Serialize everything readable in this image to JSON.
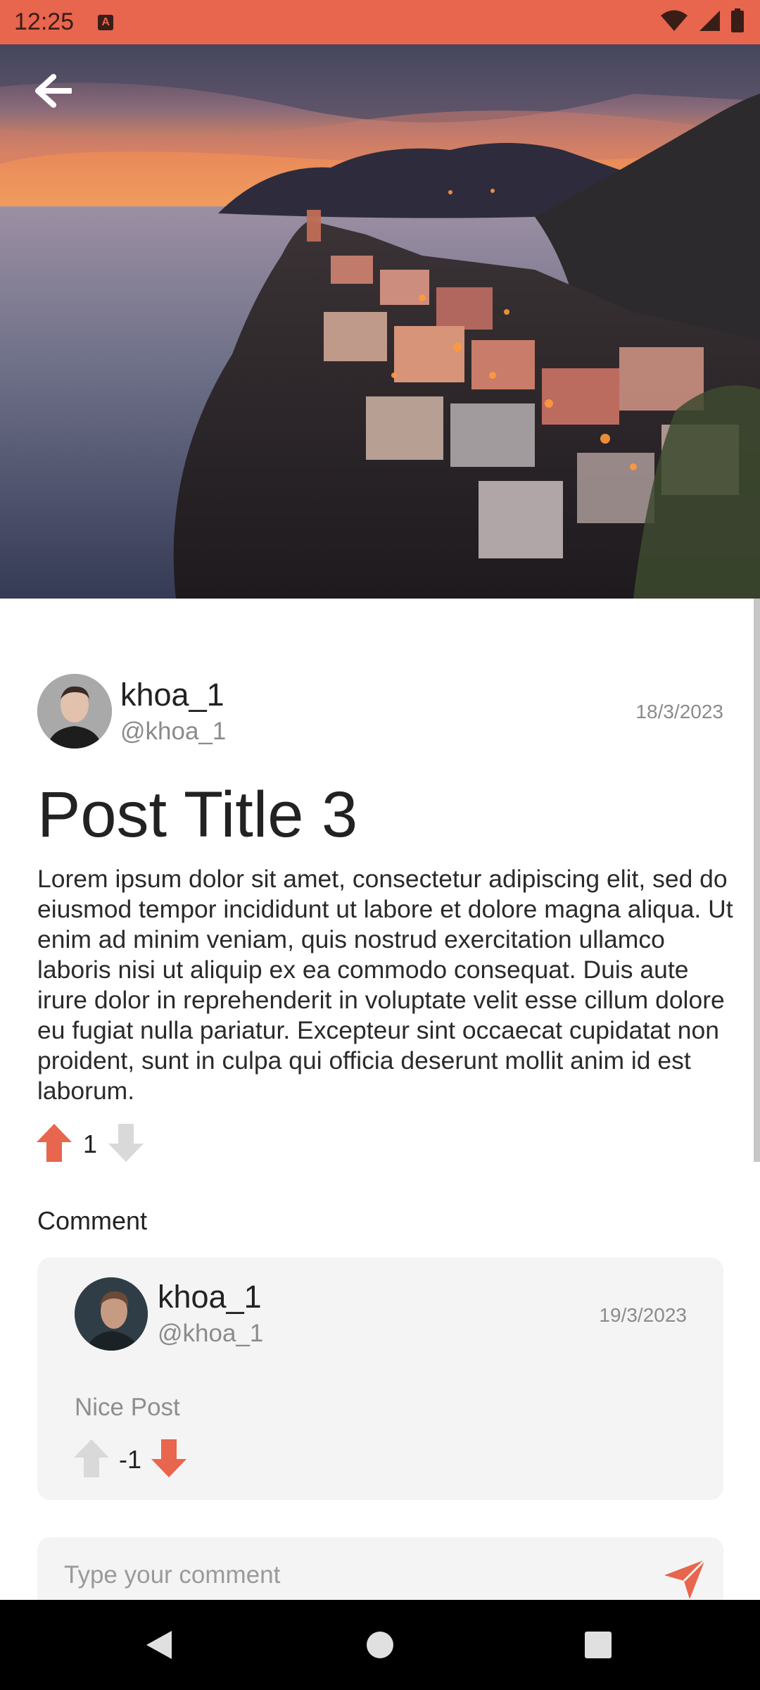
{
  "status_bar": {
    "time": "12:25",
    "notification_icon": "a-notification-icon",
    "icons": [
      "wifi-icon",
      "signal-icon",
      "battery-icon"
    ],
    "color": "#e8654e"
  },
  "header": {
    "back_icon": "arrow-left-icon",
    "hero_image": "coastal-village-sunset-photo"
  },
  "post": {
    "author": {
      "name": "khoa_1",
      "handle": "@khoa_1"
    },
    "date": "18/3/2023",
    "title": "Post Title 3",
    "body": "Lorem ipsum dolor sit amet, consectetur adipiscing elit, sed do eiusmod tempor incididunt ut labore et dolore magna aliqua. Ut enim ad minim veniam, quis nostrud exercitation ullamco laboris nisi ut aliquip ex ea commodo consequat. Duis aute irure dolor in reprehenderit in voluptate velit esse cillum dolore eu fugiat nulla pariatur. Excepteur sint occaecat cupidatat non proident, sunt in culpa qui officia deserunt mollit anim id est laborum.",
    "votes": {
      "count": "1",
      "upvoted": true,
      "downvoted": false
    }
  },
  "comments_section": {
    "heading": "Comment",
    "comments": [
      {
        "author": {
          "name": "khoa_1",
          "handle": "@khoa_1"
        },
        "date": "19/3/2023",
        "text": "Nice Post",
        "votes": {
          "count": "-1",
          "upvoted": false,
          "downvoted": true
        }
      }
    ]
  },
  "comment_input": {
    "placeholder": "Type your comment",
    "value": ""
  },
  "nav_bar": {
    "icons": [
      "back-triangle-icon",
      "home-circle-icon",
      "recents-square-icon"
    ]
  },
  "colors": {
    "accent": "#e8654e",
    "inactive": "#d9d9d9",
    "muted_text": "#8b8b8b",
    "card": "#f4f4f4"
  }
}
